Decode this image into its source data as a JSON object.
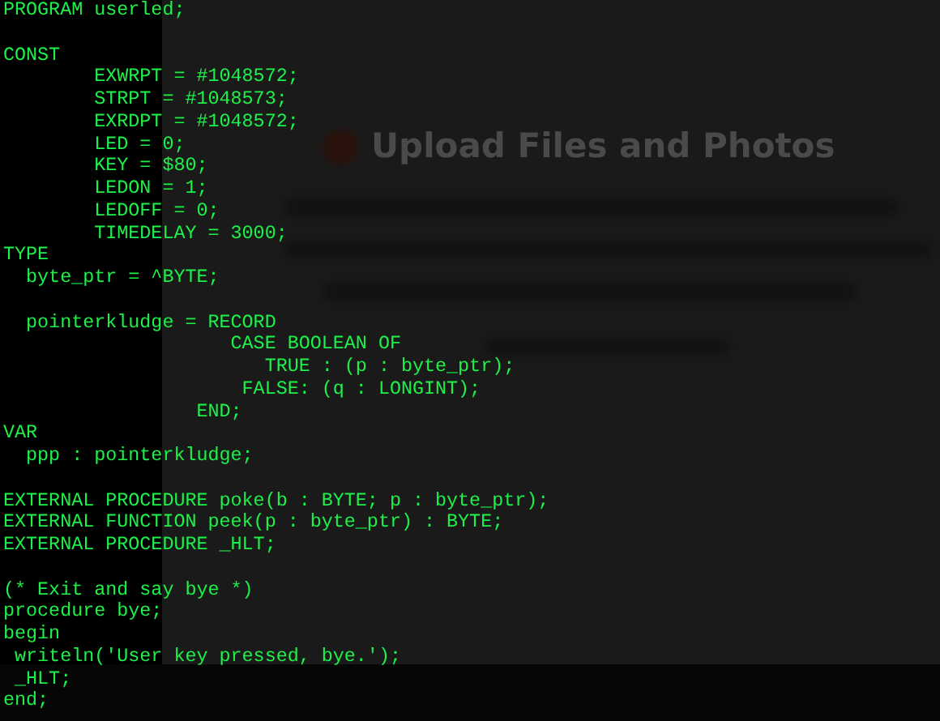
{
  "background_dialog": {
    "title": "Upload Files and Photos"
  },
  "code_blocks": [
    {
      "lines": [
        "PROGRAM userled;"
      ]
    },
    {
      "lines": [
        "CONST",
        "        EXWRPT = #1048572;",
        "        STRPT = #1048573;",
        "        EXRDPT = #1048572;",
        "        LED = 0;",
        "        KEY = $80;",
        "        LEDON = 1;",
        "        LEDOFF = 0;",
        "        TIMEDELAY = 3000;",
        "TYPE",
        "  byte_ptr = ^BYTE;"
      ]
    },
    {
      "lines": [
        "  pointerkludge = RECORD",
        "                    CASE BOOLEAN OF",
        "                       TRUE : (p : byte_ptr);",
        "                     FALSE: (q : LONGINT);",
        "                 END;",
        "VAR",
        "  ppp : pointerkludge;"
      ]
    },
    {
      "lines": [
        "EXTERNAL PROCEDURE poke(b : BYTE; p : byte_ptr);",
        "EXTERNAL FUNCTION peek(p : byte_ptr) : BYTE;",
        "EXTERNAL PROCEDURE _HLT;"
      ]
    },
    {
      "lines": [
        "(* Exit and say bye *)",
        "procedure bye;",
        "begin",
        " writeln('User key pressed, bye.');",
        " _HLT;",
        "end;"
      ]
    }
  ]
}
